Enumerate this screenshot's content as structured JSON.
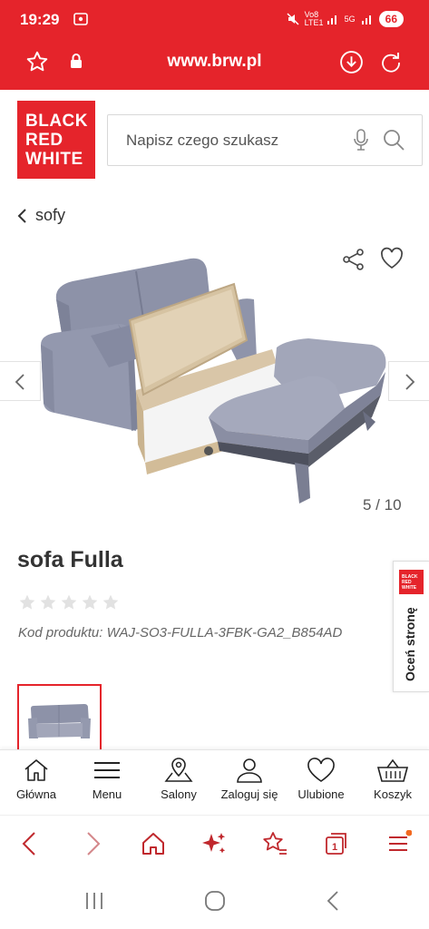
{
  "status_bar": {
    "time": "19:29",
    "network": "Vo8 LTE1",
    "network2": "5G",
    "battery": "66"
  },
  "browser": {
    "url": "www.brw.pl"
  },
  "header": {
    "logo_lines": [
      "BLACK",
      "RED",
      "WHITE"
    ],
    "search_placeholder": "Napisz czego szukasz"
  },
  "breadcrumb": {
    "label": "sofy"
  },
  "gallery": {
    "counter": "5 / 10"
  },
  "product": {
    "title": "sofa Fulla",
    "rating_stars": 0,
    "code": "Kod produktu: WAJ-SO3-FULLA-3FBK-GA2_B854AD"
  },
  "rate_tab": {
    "label": "Oceń stronę",
    "logo_lines": [
      "BLACK",
      "RED",
      "WHITE"
    ]
  },
  "site_nav": [
    {
      "label": "Główna",
      "icon": "home-icon"
    },
    {
      "label": "Menu",
      "icon": "menu-icon"
    },
    {
      "label": "Salony",
      "icon": "map-pin-icon"
    },
    {
      "label": "Zaloguj się",
      "icon": "user-icon"
    },
    {
      "label": "Ulubione",
      "icon": "heart-icon"
    },
    {
      "label": "Koszyk",
      "icon": "basket-icon"
    }
  ],
  "colors": {
    "brand_red": "#e5242b",
    "toolbar_red": "#c0282d",
    "notification_dot": "#f26a21"
  }
}
